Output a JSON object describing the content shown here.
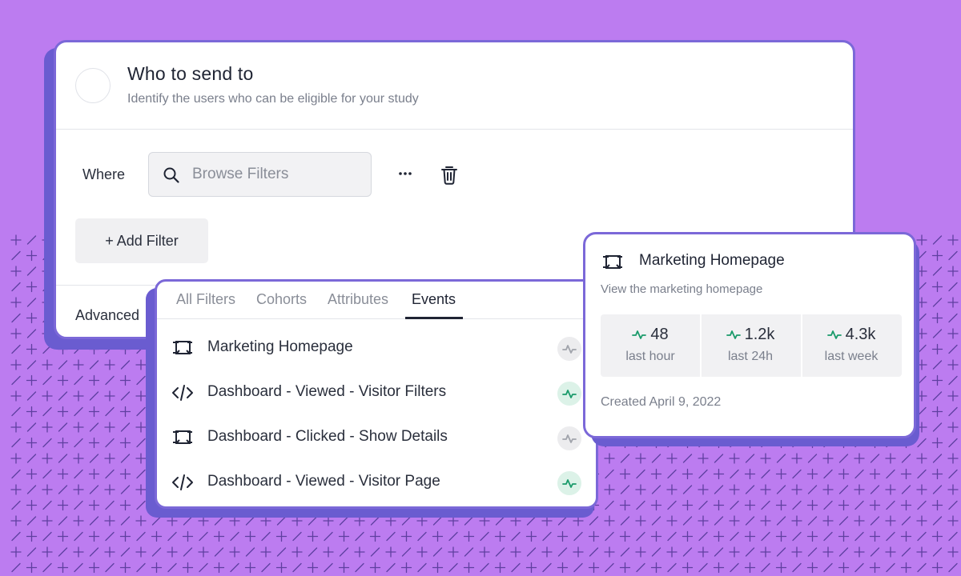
{
  "colors": {
    "background": "#bc7cf0",
    "card_border": "#7b68d8",
    "card_shadow": "#6a5cd0",
    "activity_green": "#1a9a6a",
    "activity_gray": "#a0a3ab"
  },
  "audience": {
    "title": "Who to send to",
    "subtitle": "Identify the users who can be eligible for your study",
    "where_label": "Where",
    "search_placeholder": "Browse Filters",
    "add_filter_label": "+ Add Filter",
    "advanced_label": "Advanced"
  },
  "filter_panel": {
    "tabs": [
      {
        "label": "All Filters",
        "active": false
      },
      {
        "label": "Cohorts",
        "active": false
      },
      {
        "label": "Attributes",
        "active": false
      },
      {
        "label": "Events",
        "active": true
      }
    ],
    "events": [
      {
        "label": "Marketing Homepage",
        "icon": "page-icon",
        "active": false
      },
      {
        "label": "Dashboard - Viewed - Visitor Filters",
        "icon": "code-icon",
        "active": true
      },
      {
        "label": "Dashboard - Clicked - Show Details",
        "icon": "page-icon",
        "active": false
      },
      {
        "label": "Dashboard - Viewed - Visitor Page",
        "icon": "code-icon",
        "active": true
      }
    ]
  },
  "event_detail": {
    "title": "Marketing Homepage",
    "description": "View the marketing homepage",
    "stats": [
      {
        "value": "48",
        "label": "last hour"
      },
      {
        "value": "1.2k",
        "label": "last 24h"
      },
      {
        "value": "4.3k",
        "label": "last week"
      }
    ],
    "created": "Created April 9, 2022"
  }
}
